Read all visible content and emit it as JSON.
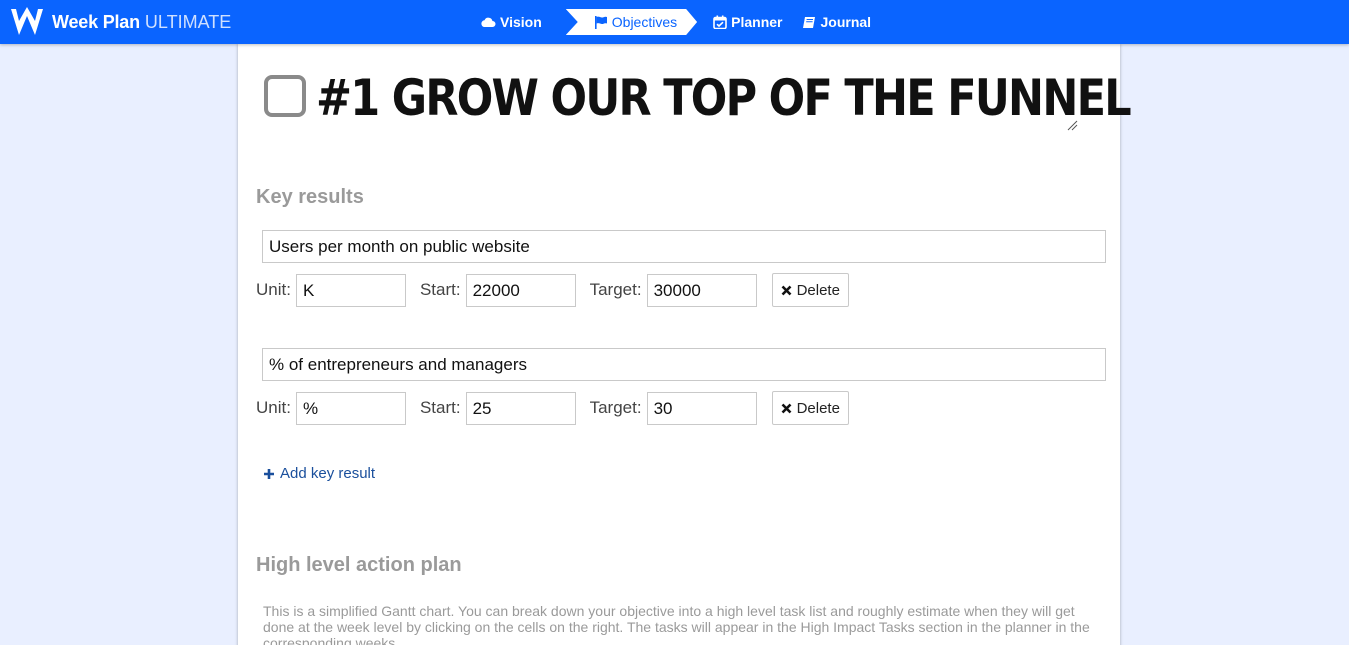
{
  "app": {
    "name": "Week Plan",
    "edition": "ULTIMATE"
  },
  "nav": {
    "items": [
      {
        "label": "Vision",
        "icon": "cloud-icon"
      },
      {
        "label": "Objectives",
        "icon": "flag-icon"
      },
      {
        "label": "Planner",
        "icon": "calendar-check-icon"
      },
      {
        "label": "Journal",
        "icon": "book-icon"
      }
    ],
    "active": "Objectives"
  },
  "objective": {
    "title": "#1 GROW OUR TOP OF THE FUNNEL",
    "completed": false
  },
  "key_results": {
    "heading": "Key results",
    "unit_label": "Unit:",
    "start_label": "Start:",
    "target_label": "Target:",
    "delete_label": "Delete",
    "items": [
      {
        "name": "Users per month on public website",
        "unit": "K",
        "start": "22000",
        "target": "30000"
      },
      {
        "name": "% of entrepreneurs and managers",
        "unit": "%",
        "start": "25",
        "target": "30"
      }
    ],
    "add_label": "Add key result"
  },
  "action_plan": {
    "heading": "High level action plan",
    "description": "This is a simplified Gantt chart. You can break down your objective into a high level task list and roughly estimate when they will get done at the week level by clicking on the cells on the right. The tasks will appear in the High Impact Tasks section in the planner in the corresponding weeks."
  },
  "colors": {
    "topbar": "#0a64ff",
    "background": "#e9efff",
    "heading_gray": "#9a9a9a",
    "link_blue": "#1a4f9c"
  }
}
